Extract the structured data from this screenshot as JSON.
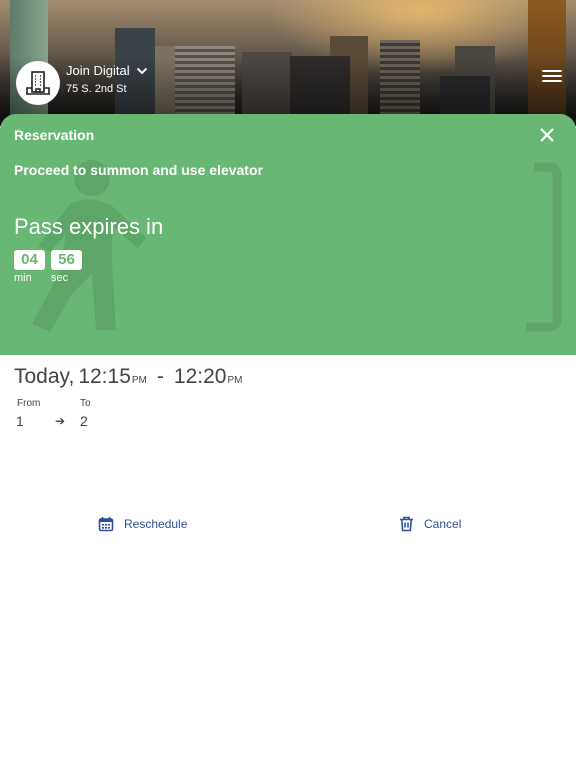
{
  "header": {
    "site_name": "Join Digital",
    "site_address": "75 S. 2nd St",
    "icons": {
      "avatar": "building-icon",
      "dropdown": "chevron-down-icon",
      "menu": "hamburger-menu-icon"
    }
  },
  "reservation": {
    "title": "Reservation",
    "instruction": "Proceed to summon and use elevator",
    "expires_label": "Pass expires in",
    "timer": {
      "minutes": "04",
      "minutes_label": "min",
      "seconds": "56",
      "seconds_label": "sec"
    },
    "icons": {
      "close": "close-icon",
      "walking": "walking-person-icon",
      "door": "door-bracket-icon"
    },
    "colors": {
      "panel": "#68b773",
      "action": "#2e4f9a"
    }
  },
  "details": {
    "day": "Today,",
    "start_time": "12:15",
    "start_ampm": "PM",
    "separator": "-",
    "end_time": "12:20",
    "end_ampm": "PM",
    "from_label": "From",
    "from_value": "1",
    "to_label": "To",
    "to_value": "2",
    "arrow": "➔"
  },
  "actions": {
    "reschedule_label": "Reschedule",
    "cancel_label": "Cancel"
  }
}
